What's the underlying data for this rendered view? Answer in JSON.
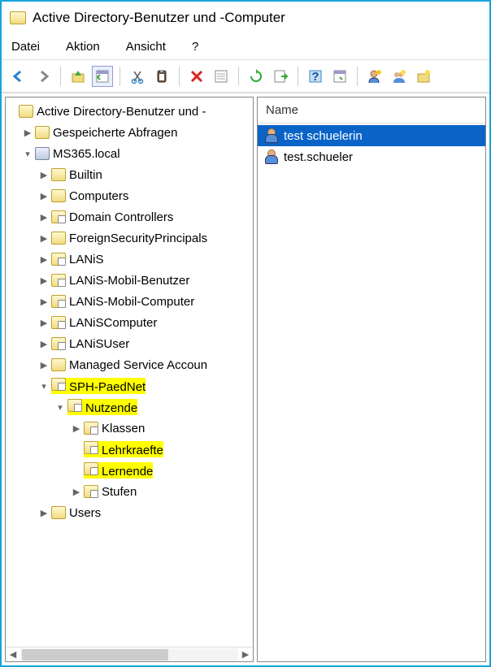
{
  "title": "Active Directory-Benutzer und -Computer",
  "menus": {
    "file": "Datei",
    "action": "Aktion",
    "view": "Ansicht",
    "help": "?"
  },
  "tree": {
    "root": "Active Directory-Benutzer und -",
    "savedQueries": "Gespeicherte Abfragen",
    "domain": "MS365.local",
    "builtin": "Builtin",
    "computers": "Computers",
    "domainControllers": "Domain Controllers",
    "fsp": "ForeignSecurityPrincipals",
    "lanis": "LANiS",
    "lanisMobilBenutzer": "LANiS-Mobil-Benutzer",
    "lanisMobilComputer": "LANiS-Mobil-Computer",
    "lanisComputer": "LANiSComputer",
    "lanisUser": "LANiSUser",
    "msa": "Managed Service Accoun",
    "sphPaedNet": "SPH-PaedNet",
    "nutzende": "Nutzende",
    "klassen": "Klassen",
    "lehrkraefte": "Lehrkraefte",
    "lernende": "Lernende",
    "stufen": "Stufen",
    "users": "Users"
  },
  "list": {
    "headerName": "Name",
    "rows": [
      {
        "name": "test schuelerin",
        "selected": true
      },
      {
        "name": "test.schueler",
        "selected": false
      }
    ]
  }
}
